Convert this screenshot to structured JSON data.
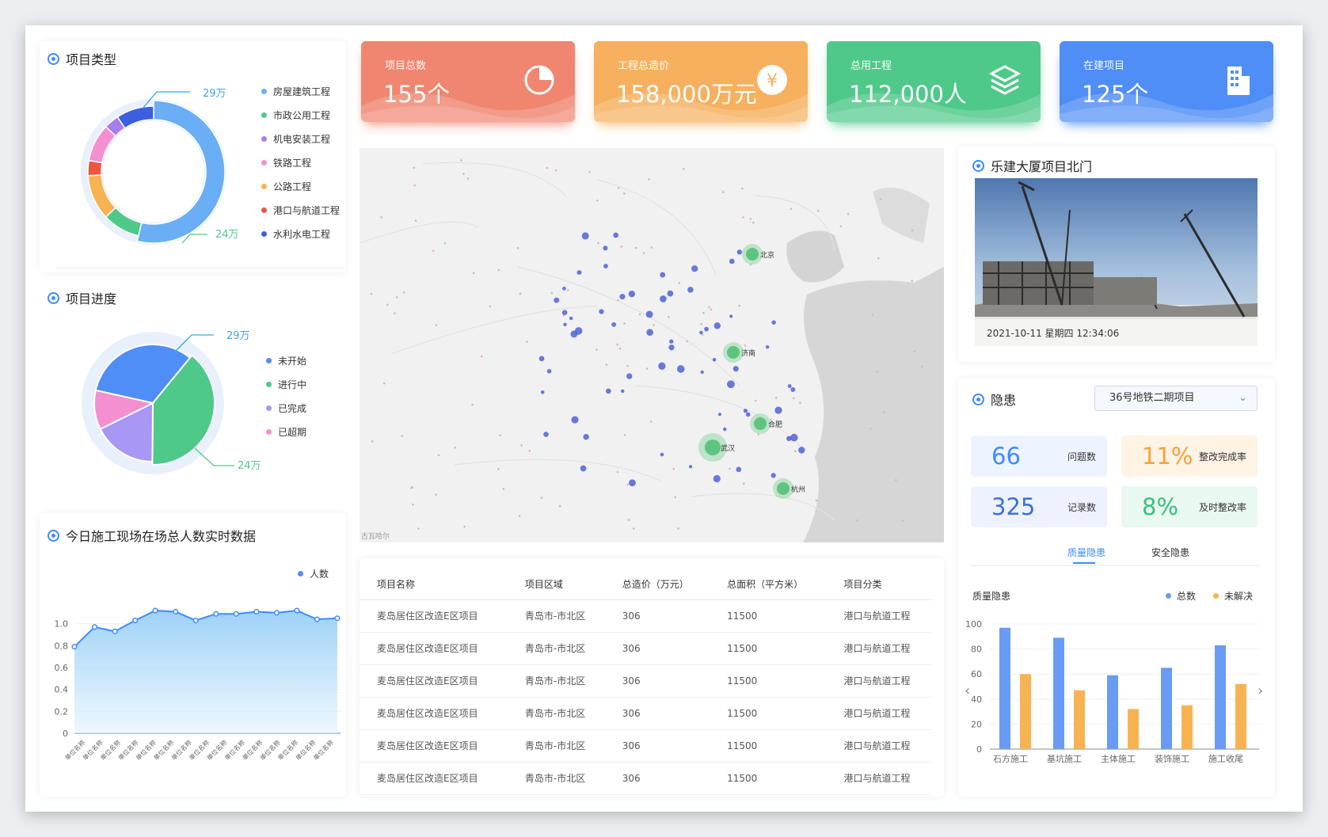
{
  "kpis": [
    {
      "label": "项目总数",
      "value": "155个",
      "color": "#f08670",
      "icon": "pie-chart-icon"
    },
    {
      "label": "工程总造价",
      "value": "158,000万元",
      "color": "#f6b05e",
      "icon": "yen-coin-icon"
    },
    {
      "label": "总用工程",
      "value": "112,000人",
      "color": "#4fc98a",
      "icon": "layers-icon"
    },
    {
      "label": "在建项目",
      "value": "125个",
      "color": "#4f8ef6",
      "icon": "building-icon"
    }
  ],
  "project_type": {
    "title": "项目类型",
    "callouts": [
      "29万",
      "24万"
    ],
    "legend": [
      {
        "label": "房屋建筑工程",
        "color": "#6aaff5"
      },
      {
        "label": "市政公用工程",
        "color": "#4fc98a"
      },
      {
        "label": "机电安装工程",
        "color": "#a97cf0"
      },
      {
        "label": "铁路工程",
        "color": "#f48fd0"
      },
      {
        "label": "公路工程",
        "color": "#f7b352"
      },
      {
        "label": "港口与航道工程",
        "color": "#f0553f"
      },
      {
        "label": "水利水电工程",
        "color": "#3c5fe0"
      }
    ],
    "chart_data": {
      "type": "pie",
      "labels": [
        "房屋建筑工程",
        "市政公用工程",
        "公路工程",
        "港口与航道工程",
        "铁路工程",
        "机电安装工程",
        "水利水电工程"
      ],
      "values": [
        29,
        5,
        6,
        2,
        5,
        2,
        5
      ]
    }
  },
  "project_progress": {
    "title": "项目进度",
    "callouts": [
      "29万",
      "24万"
    ],
    "legend": [
      {
        "label": "未开始",
        "color": "#4f8ef6"
      },
      {
        "label": "进行中",
        "color": "#4fc98a"
      },
      {
        "label": "已完成",
        "color": "#a897f5"
      },
      {
        "label": "已超期",
        "color": "#f48fd0"
      }
    ],
    "chart_data": {
      "type": "pie",
      "labels": [
        "未开始",
        "进行中",
        "已完成",
        "已超期"
      ],
      "values": [
        24,
        29,
        13,
        8
      ]
    }
  },
  "realtime": {
    "title": "今日施工现场在场总人数实时数据",
    "legend": "人数",
    "chart_data": {
      "type": "area",
      "series_name": "人数",
      "x_label": "单位名称",
      "x": [
        "单位名称",
        "单位名称",
        "单位名称",
        "单位名称",
        "单位名称",
        "单位名称",
        "单位名称",
        "单位名称",
        "单位名称",
        "单位名称",
        "单位名称",
        "单位名称",
        "单位名称",
        "单位名称",
        "单位名称"
      ],
      "values": [
        0.79,
        0.97,
        0.93,
        1.03,
        1.12,
        1.11,
        1.03,
        1.09,
        1.09,
        1.11,
        1.1,
        1.12,
        1.04,
        1.05
      ],
      "y_ticks": [
        "0",
        "0.2",
        "0.4",
        "0.6",
        "0.8",
        "1.0"
      ],
      "ylim": [
        0,
        1.2
      ]
    }
  },
  "map": {
    "footer": "古瓦哈尔",
    "cities": [
      "北京",
      "济南",
      "合肥",
      "武汉",
      "杭州"
    ],
    "hotspot_count": 5
  },
  "table": {
    "headers": [
      "项目名称",
      "项目区域",
      "总造价（万元）",
      "总面积（平方米）",
      "项目分类"
    ],
    "rows": [
      [
        "麦岛居住区改造E区项目",
        "青岛市-市北区",
        "306",
        "11500",
        "港口与航道工程"
      ],
      [
        "麦岛居住区改造E区项目",
        "青岛市-市北区",
        "306",
        "11500",
        "港口与航道工程"
      ],
      [
        "麦岛居住区改造E区项目",
        "青岛市-市北区",
        "306",
        "11500",
        "港口与航道工程"
      ],
      [
        "麦岛居住区改造E区项目",
        "青岛市-市北区",
        "306",
        "11500",
        "港口与航道工程"
      ],
      [
        "麦岛居住区改造E区项目",
        "青岛市-市北区",
        "306",
        "11500",
        "港口与航道工程"
      ],
      [
        "麦岛居住区改造E区项目",
        "青岛市-市北区",
        "306",
        "11500",
        "港口与航道工程"
      ]
    ]
  },
  "camera": {
    "title": "乐建大厦项目北门",
    "timestamp": "2021-10-11 星期四 12:34:06"
  },
  "hazard": {
    "title": "隐患",
    "select": "36号地铁二期项目",
    "stats": [
      {
        "num": "66",
        "label": "问题数",
        "bg": "#eef4ff",
        "color": "#3d8bff"
      },
      {
        "num": "11%",
        "label": "整改完成率",
        "bg": "#fff3e4",
        "color": "#f5a23a"
      },
      {
        "num": "325",
        "label": "记录数",
        "bg": "#eef2ff",
        "color": "#3d6fe0"
      },
      {
        "num": "8%",
        "label": "及时整改率",
        "bg": "#e9f8f0",
        "color": "#36c27c"
      }
    ],
    "tabs": [
      "质量隐患",
      "安全隐患"
    ],
    "active_tab": "质量隐患",
    "chart_title": "质量隐患",
    "legend": [
      {
        "label": "总数",
        "color": "#6a9bf4"
      },
      {
        "label": "未解决",
        "color": "#f7b352"
      }
    ],
    "chart_data": {
      "type": "bar",
      "categories": [
        "石方施工",
        "基坑施工",
        "主体施工",
        "装饰施工",
        "施工收尾"
      ],
      "series": [
        {
          "name": "总数",
          "values": [
            97,
            89,
            59,
            65,
            83
          ]
        },
        {
          "name": "未解决",
          "values": [
            60,
            47,
            32,
            35,
            52
          ]
        }
      ],
      "y_ticks": [
        "0",
        "20",
        "40",
        "60",
        "80",
        "100"
      ],
      "ylim": [
        0,
        100
      ]
    }
  }
}
